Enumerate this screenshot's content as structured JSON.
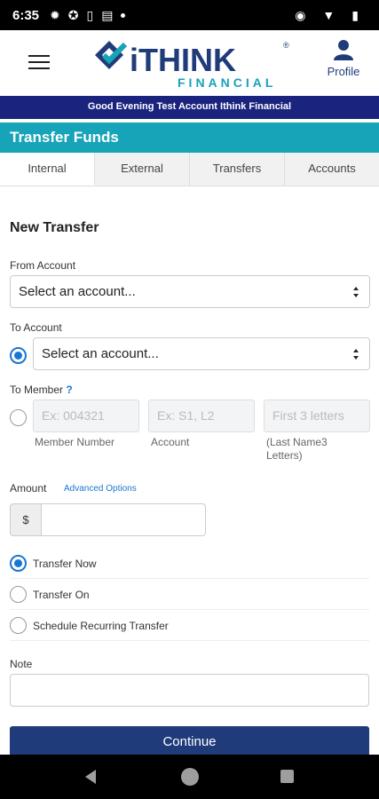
{
  "status_bar": {
    "time": "6:35"
  },
  "header": {
    "logo_text": "iTHINK",
    "logo_sub": "FINANCIAL",
    "profile_label": "Profile",
    "greeting": "Good Evening Test Account Ithink Financial"
  },
  "page": {
    "title": "Transfer Funds"
  },
  "tabs": [
    {
      "label": "Internal"
    },
    {
      "label": "External"
    },
    {
      "label": "Transfers"
    },
    {
      "label": "Accounts"
    }
  ],
  "form": {
    "heading": "New Transfer",
    "from_label": "From Account",
    "from_value": "Select an account...",
    "to_label": "To Account",
    "to_value": "Select an account...",
    "member_label": "To Member",
    "member_help": "?",
    "member_number_placeholder": "Ex: 004321",
    "member_account_placeholder": "Ex: S1, L2",
    "member_letters_placeholder": "First 3 letters",
    "member_number_caption": "Member Number",
    "member_account_caption": "Account",
    "member_letters_caption_1": "(Last Name3",
    "member_letters_caption_2": "Letters)",
    "amount_label": "Amount",
    "advanced_options": "Advanced Options",
    "currency_symbol": "$",
    "options": [
      {
        "label": "Transfer Now",
        "selected": true
      },
      {
        "label": "Transfer On",
        "selected": false
      },
      {
        "label": "Schedule Recurring Transfer",
        "selected": false
      }
    ],
    "note_label": "Note",
    "continue_label": "Continue"
  },
  "colors": {
    "brand_navy": "#1f3b7a",
    "brand_teal": "#17a3b8",
    "greeting_bg": "#1a237e",
    "accent_blue": "#1976d2"
  }
}
